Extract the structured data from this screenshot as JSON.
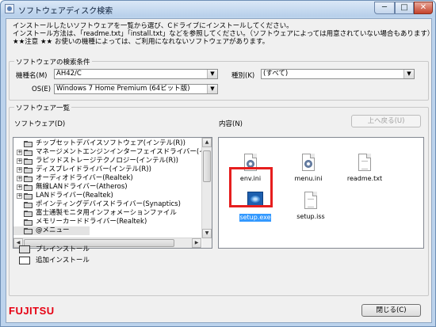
{
  "window": {
    "title": "ソフトウェアディスク検索",
    "controls": {
      "minimize": "─",
      "maximize": "□",
      "close": "✕"
    }
  },
  "instructions": [
    "インストールしたいソフトウェアを一覧から選び、Cドライブにインストールしてください。",
    "インストール方法は、「readme.txt」「install.txt」などを参照してください。（ソフトウェアによっては用意されていない場合もあります）",
    "★★注意 ★★ お使いの機種によっては、ご利用になれないソフトウェアがあります。"
  ],
  "search": {
    "group_label": "ソフトウェアの検索条件",
    "model_label": "機種名(M)",
    "model_value": "AH42/C",
    "os_label": "OS(E)",
    "os_value": "Windows 7 Home Premium (64ビット版)",
    "type_label": "種別(K)",
    "type_value": "(すべて)"
  },
  "list": {
    "group_label": "ソフトウェア一覧",
    "software_label": "ソフトウェア(D)",
    "content_label": "内容(N)",
    "up_button": "上へ戻る(U)",
    "tree": [
      {
        "label": "チップセットデバイスソフトウェア(インテル(R))",
        "expandable": false
      },
      {
        "label": "マネージメントエンジンインターフェイスドライバー(インテル",
        "expandable": true
      },
      {
        "label": "ラピッドストレージテクノロジー(インテル(R))",
        "expandable": true
      },
      {
        "label": "ディスプレイドライバー(インテル(R))",
        "expandable": true
      },
      {
        "label": "オーディオドライバー(Realtek)",
        "expandable": true
      },
      {
        "label": "無線LANドライバー(Atheros)",
        "expandable": true
      },
      {
        "label": "LANドライバー(Realtek)",
        "expandable": true
      },
      {
        "label": "ポインティングデバイスドライバー(Synaptics)",
        "expandable": false
      },
      {
        "label": "富士通製モニタ用インフォメーションファイル",
        "expandable": false
      },
      {
        "label": "メモリーカードドライバー(Realtek)",
        "expandable": false
      },
      {
        "label": "@メニュー",
        "expandable": false
      }
    ],
    "files": [
      {
        "name": "env.ini",
        "icon": "ini-gear-icon"
      },
      {
        "name": "menu.ini",
        "icon": "ini-gear-icon"
      },
      {
        "name": "readme.txt",
        "icon": "text-file-icon"
      },
      {
        "name": "setup.exe",
        "icon": "exe-icon",
        "selected": true
      },
      {
        "name": "setup.iss",
        "icon": "blank-file-icon"
      }
    ]
  },
  "legend": [
    {
      "label": "プレインストール"
    },
    {
      "label": "追加インストール"
    }
  ],
  "footer": {
    "close_button": "閉じる(C)",
    "logo": "FUJITSU"
  },
  "colors": {
    "highlight_box": "#e61e1e",
    "selection": "#3399ff",
    "logo": "#e60012"
  }
}
